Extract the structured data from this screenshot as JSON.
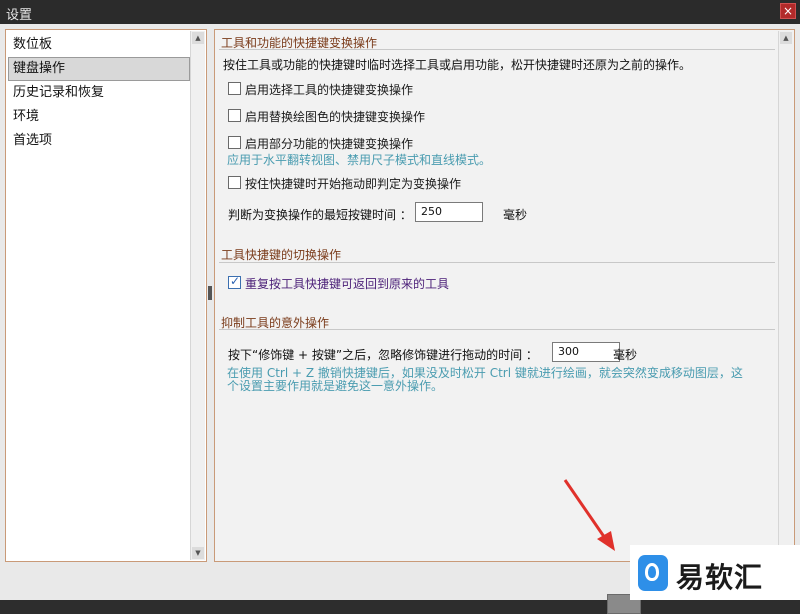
{
  "window": {
    "title": "设置",
    "close_label": "×"
  },
  "sidebar": {
    "items": [
      {
        "label": "数位板",
        "selected": false
      },
      {
        "label": "键盘操作",
        "selected": true
      },
      {
        "label": "历史记录和恢复",
        "selected": false
      },
      {
        "label": "环境",
        "selected": false
      },
      {
        "label": "首选项",
        "selected": false
      }
    ]
  },
  "content": {
    "section1": {
      "title": "工具和功能的快捷键变换操作",
      "description": "按住工具或功能的快捷键时临时选择工具或启用功能，松开快捷键时还原为之前的操作。",
      "checkboxes": [
        {
          "label": "启用选择工具的快捷键变换操作",
          "checked": false
        },
        {
          "label": "启用替换绘图色的快捷键变换操作",
          "checked": false
        },
        {
          "label": "启用部分功能的快捷键变换操作",
          "checked": false
        }
      ],
      "hint": "应用于水平翻转视图、禁用尺子模式和直线模式。",
      "drag_checkbox": {
        "label": "按住快捷键时开始拖动即判定为变换操作",
        "checked": false
      },
      "min_time_label": "判断为变换操作的最短按键时间 ：",
      "min_time_value": "250",
      "min_time_unit": "毫秒"
    },
    "section2": {
      "title": "工具快捷键的切换操作",
      "checkbox": {
        "label": "重复按工具快捷键可返回到原来的工具",
        "checked": true
      }
    },
    "section3": {
      "title": "抑制工具的意外操作",
      "ignore_label": "按下“修饰键 + 按键”之后，忽略修饰键进行拖动的时间 ：",
      "ignore_value": "300",
      "ignore_unit": "毫秒",
      "hint_line1": "在使用 Ctrl + Z 撤销快捷键后，如果没及时松开 Ctrl 键就进行绘画，就会突然变成移动图层，这",
      "hint_line2": "个设置主要作用就是避免这一意外操作。"
    }
  },
  "watermark": {
    "text": "易软汇",
    "logo_color": "#2e8fe8"
  },
  "colors": {
    "section_title": "#7a3b1a",
    "hint": "#4a9cb0",
    "annotation_arrow": "#e0312b"
  }
}
